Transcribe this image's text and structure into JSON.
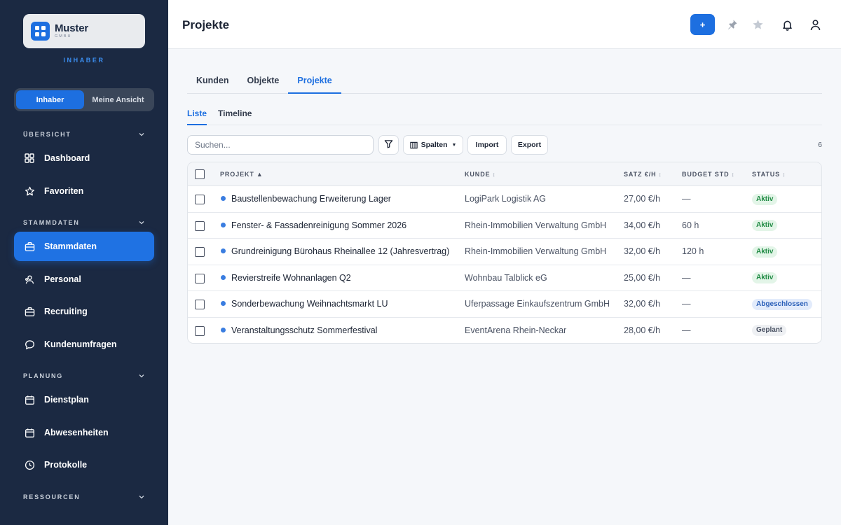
{
  "brand": {
    "name": "Muster",
    "sub": "GMBH",
    "role": "INHABER"
  },
  "view_toggle": {
    "options": [
      "Inhaber",
      "Meine Ansicht"
    ],
    "selected": "Inhaber"
  },
  "sidebar": {
    "sections": [
      {
        "label": "ÜBERSICHT",
        "items": [
          {
            "label": "Dashboard",
            "icon": "grid-icon"
          },
          {
            "label": "Favoriten",
            "icon": "star-icon"
          }
        ]
      },
      {
        "label": "STAMMDATEN",
        "items": [
          {
            "label": "Stammdaten",
            "icon": "briefcase-icon",
            "active": true
          },
          {
            "label": "Personal",
            "icon": "people-icon"
          },
          {
            "label": "Recruiting",
            "icon": "briefcase-icon"
          },
          {
            "label": "Kundenumfragen",
            "icon": "chat-icon"
          }
        ]
      },
      {
        "label": "PLANUNG",
        "items": [
          {
            "label": "Dienstplan",
            "icon": "calendar-icon"
          },
          {
            "label": "Abwesenheiten",
            "icon": "calendar-icon"
          },
          {
            "label": "Protokolle",
            "icon": "clock-icon"
          }
        ]
      },
      {
        "label": "RESSOURCEN",
        "items": []
      }
    ]
  },
  "header": {
    "title": "Projekte",
    "add_label": "+",
    "icons": [
      "pin-icon",
      "star-icon",
      "bell-icon",
      "user-icon"
    ]
  },
  "tabs": {
    "items": [
      "Kunden",
      "Objekte",
      "Projekte"
    ],
    "active": "Projekte"
  },
  "subtabs": {
    "items": [
      "Liste",
      "Timeline"
    ],
    "active": "Liste"
  },
  "toolbar": {
    "search_placeholder": "Suchen...",
    "columns_label": "Spalten",
    "import_label": "Import",
    "export_label": "Export",
    "count": "6"
  },
  "table": {
    "columns": [
      {
        "label": "PROJEKT",
        "sort": "▲"
      },
      {
        "label": "KUNDE",
        "sort": "↕"
      },
      {
        "label": "SATZ €/H",
        "sort": "↕"
      },
      {
        "label": "BUDGET STD",
        "sort": "↕"
      },
      {
        "label": "STATUS",
        "sort": "↕"
      }
    ],
    "rows": [
      {
        "projekt": "Baustellenbewachung Erweiterung Lager",
        "kunde": "LogiPark Logistik AG",
        "satz": "27,00 €/h",
        "budget": "—",
        "status": "Aktiv",
        "status_type": "aktiv"
      },
      {
        "projekt": "Fenster- & Fassadenreinigung Sommer 2026",
        "kunde": "Rhein-Immobilien Verwaltung GmbH",
        "satz": "34,00 €/h",
        "budget": "60 h",
        "status": "Aktiv",
        "status_type": "aktiv"
      },
      {
        "projekt": "Grundreinigung Bürohaus Rheinallee 12 (Jahresvertrag)",
        "kunde": "Rhein-Immobilien Verwaltung GmbH",
        "satz": "32,00 €/h",
        "budget": "120 h",
        "status": "Aktiv",
        "status_type": "aktiv"
      },
      {
        "projekt": "Revierstreife Wohnanlagen Q2",
        "kunde": "Wohnbau Talblick eG",
        "satz": "25,00 €/h",
        "budget": "—",
        "status": "Aktiv",
        "status_type": "aktiv"
      },
      {
        "projekt": "Sonderbewachung Weihnachtsmarkt LU",
        "kunde": "Uferpassage Einkaufszentrum GmbH",
        "satz": "32,00 €/h",
        "budget": "—",
        "status": "Abgeschlossen",
        "status_type": "abgeschlossen"
      },
      {
        "projekt": "Veranstaltungsschutz Sommerfestival",
        "kunde": "EventArena Rhein-Neckar",
        "satz": "28,00 €/h",
        "budget": "—",
        "status": "Geplant",
        "status_type": "geplant"
      }
    ]
  },
  "colors": {
    "sidebar_bg": "#1b2942",
    "accent": "#1d6fe0",
    "page_bg": "#f5f7fa"
  }
}
